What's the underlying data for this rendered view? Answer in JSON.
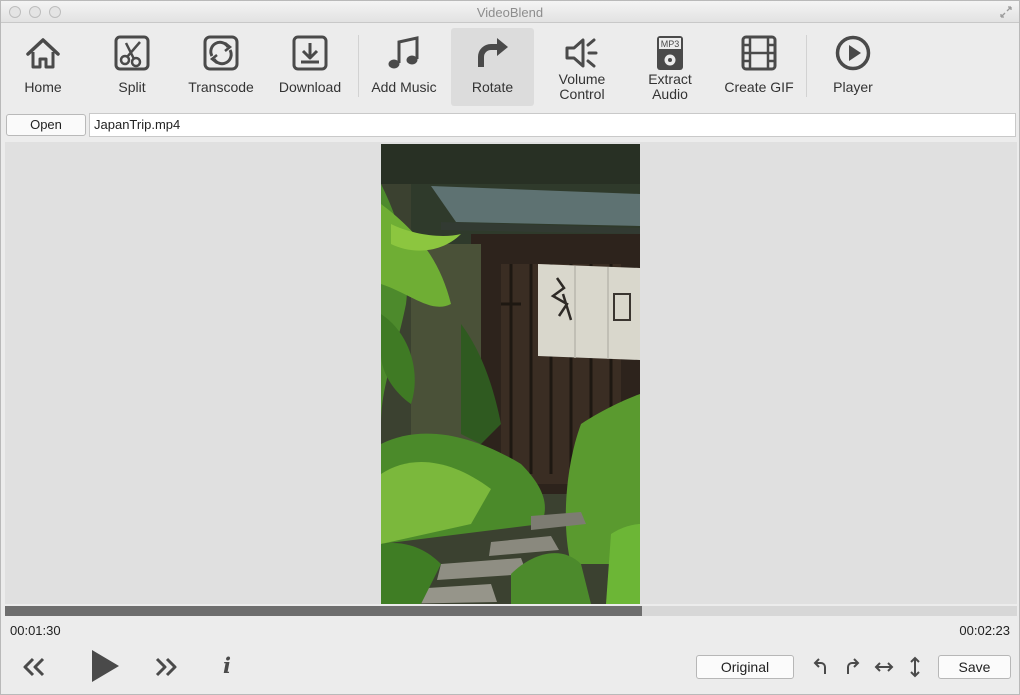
{
  "window": {
    "title": "VideoBlend"
  },
  "toolbar": {
    "items": [
      {
        "label": "Home",
        "icon": "home-icon"
      },
      {
        "label": "Split",
        "icon": "scissors-icon"
      },
      {
        "label": "Transcode",
        "icon": "transcode-icon"
      },
      {
        "label": "Download",
        "icon": "download-icon"
      },
      {
        "label": "Add Music",
        "icon": "music-note-icon"
      },
      {
        "label": "Rotate",
        "icon": "rotate-icon",
        "active": true
      },
      {
        "label": "Volume\nControl",
        "icon": "volume-icon"
      },
      {
        "label": "Extract\nAudio",
        "icon": "mp3-file-icon",
        "icon_text": "MP3"
      },
      {
        "label": "Create GIF",
        "icon": "film-strip-icon"
      },
      {
        "label": "Player",
        "icon": "play-circle-icon"
      }
    ]
  },
  "file": {
    "open_label": "Open",
    "path": "JapanTrip.mp4"
  },
  "playback": {
    "current_time": "00:01:30",
    "total_time": "00:02:23",
    "progress": 0.629
  },
  "controls": {
    "original_label": "Original",
    "save_label": "Save",
    "icons": [
      "rewind-icon",
      "play-icon",
      "fast-forward-icon",
      "info-icon",
      "rotate-left-icon",
      "rotate-right-icon",
      "flip-horizontal-icon",
      "flip-vertical-icon"
    ],
    "info_glyph": "i"
  },
  "colors": {
    "accent": "#6e6e6e",
    "icon": "#4a4a4a",
    "active_tool": "#dcdcdc"
  }
}
